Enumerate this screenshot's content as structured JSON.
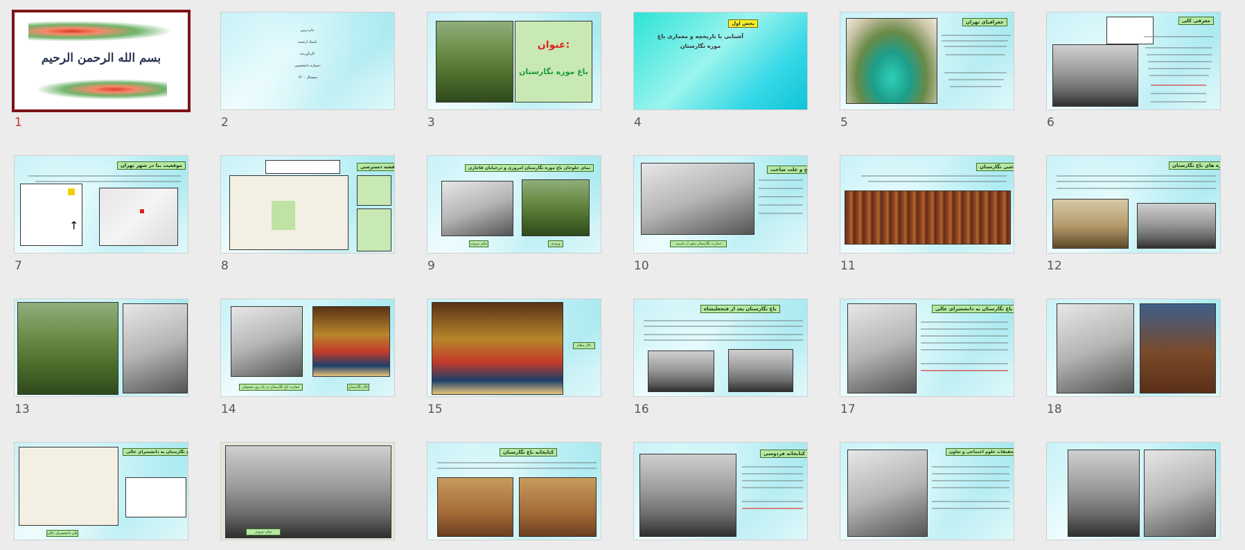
{
  "app": {
    "name": "Slide Sorter"
  },
  "selected_slide": 1,
  "slides": [
    {
      "num": "1",
      "title": "بسم الله الرحمن الرحیم"
    },
    {
      "num": "2",
      "title": "",
      "lines": [
        "نام درس:",
        "استاد ارجمند:",
        "گردآورنده:",
        "شماره دانشجویی:",
        "نیمسال ۱۴۰۰"
      ]
    },
    {
      "num": "3",
      "title": "عنوان:",
      "subtitle": "باغ موزه نگارستان"
    },
    {
      "num": "4",
      "title": "بخش اول",
      "subtitle": "آشنایی با تاریخچه و معماری باغ موزه نگارستان"
    },
    {
      "num": "5",
      "title": "جغرافیای تهران"
    },
    {
      "num": "6",
      "title": "معرفی کلی"
    },
    {
      "num": "7",
      "title": "موقعیت بنا در شهر تهران"
    },
    {
      "num": "8",
      "title": "نقشه دسترسی"
    },
    {
      "num": "9",
      "title": "نمای جلوخان باغ موزه نگارستان امروزی و درخیابان قاجاری",
      "caps": [
        "نمای بیرونی",
        "ورودی"
      ]
    },
    {
      "num": "10",
      "title": "تاریخ و علت ساخت",
      "caps": [
        "عمارت نگارستان پیش از تخریب"
      ]
    },
    {
      "num": "11",
      "title": "نقاشی نگارستان"
    },
    {
      "num": "12",
      "title": "سازه های باغ نگارستان"
    },
    {
      "num": "13",
      "title": ""
    },
    {
      "num": "14",
      "title": "",
      "caps": [
        "عمارت باغ نگارستان در یک روز معمولی",
        "تالار نگارستان"
      ]
    },
    {
      "num": "15",
      "title": "",
      "caps": [
        "تالار سلام"
      ]
    },
    {
      "num": "16",
      "title": "باغ نگارستان بعد از فتحعلیشاه"
    },
    {
      "num": "17",
      "title": "تبدیل باغ نگارستان به دانشسرای عالی"
    },
    {
      "num": "18",
      "title": ""
    },
    {
      "num": "19",
      "title": "تبدیل باغ نگارستان به دانشسرای عالی",
      "caps": [
        "پلان دانشسرای عالی"
      ]
    },
    {
      "num": "20",
      "title": "",
      "caps": [
        "نمای بیرونی"
      ]
    },
    {
      "num": "21",
      "title": "کتابخانه باغ نگارستان"
    },
    {
      "num": "22",
      "title": "کتابخانه فردوسی"
    },
    {
      "num": "23",
      "title": "تبدیل به موسسه تحقیقات علوم اجتماعی و تعاون"
    },
    {
      "num": "24",
      "title": ""
    }
  ],
  "colors": {
    "selection": "#7b1418",
    "slide_bg": "#c9f2f7",
    "tag_green": "#b6e8a4",
    "tag_yellow": "#f7ef2a"
  }
}
